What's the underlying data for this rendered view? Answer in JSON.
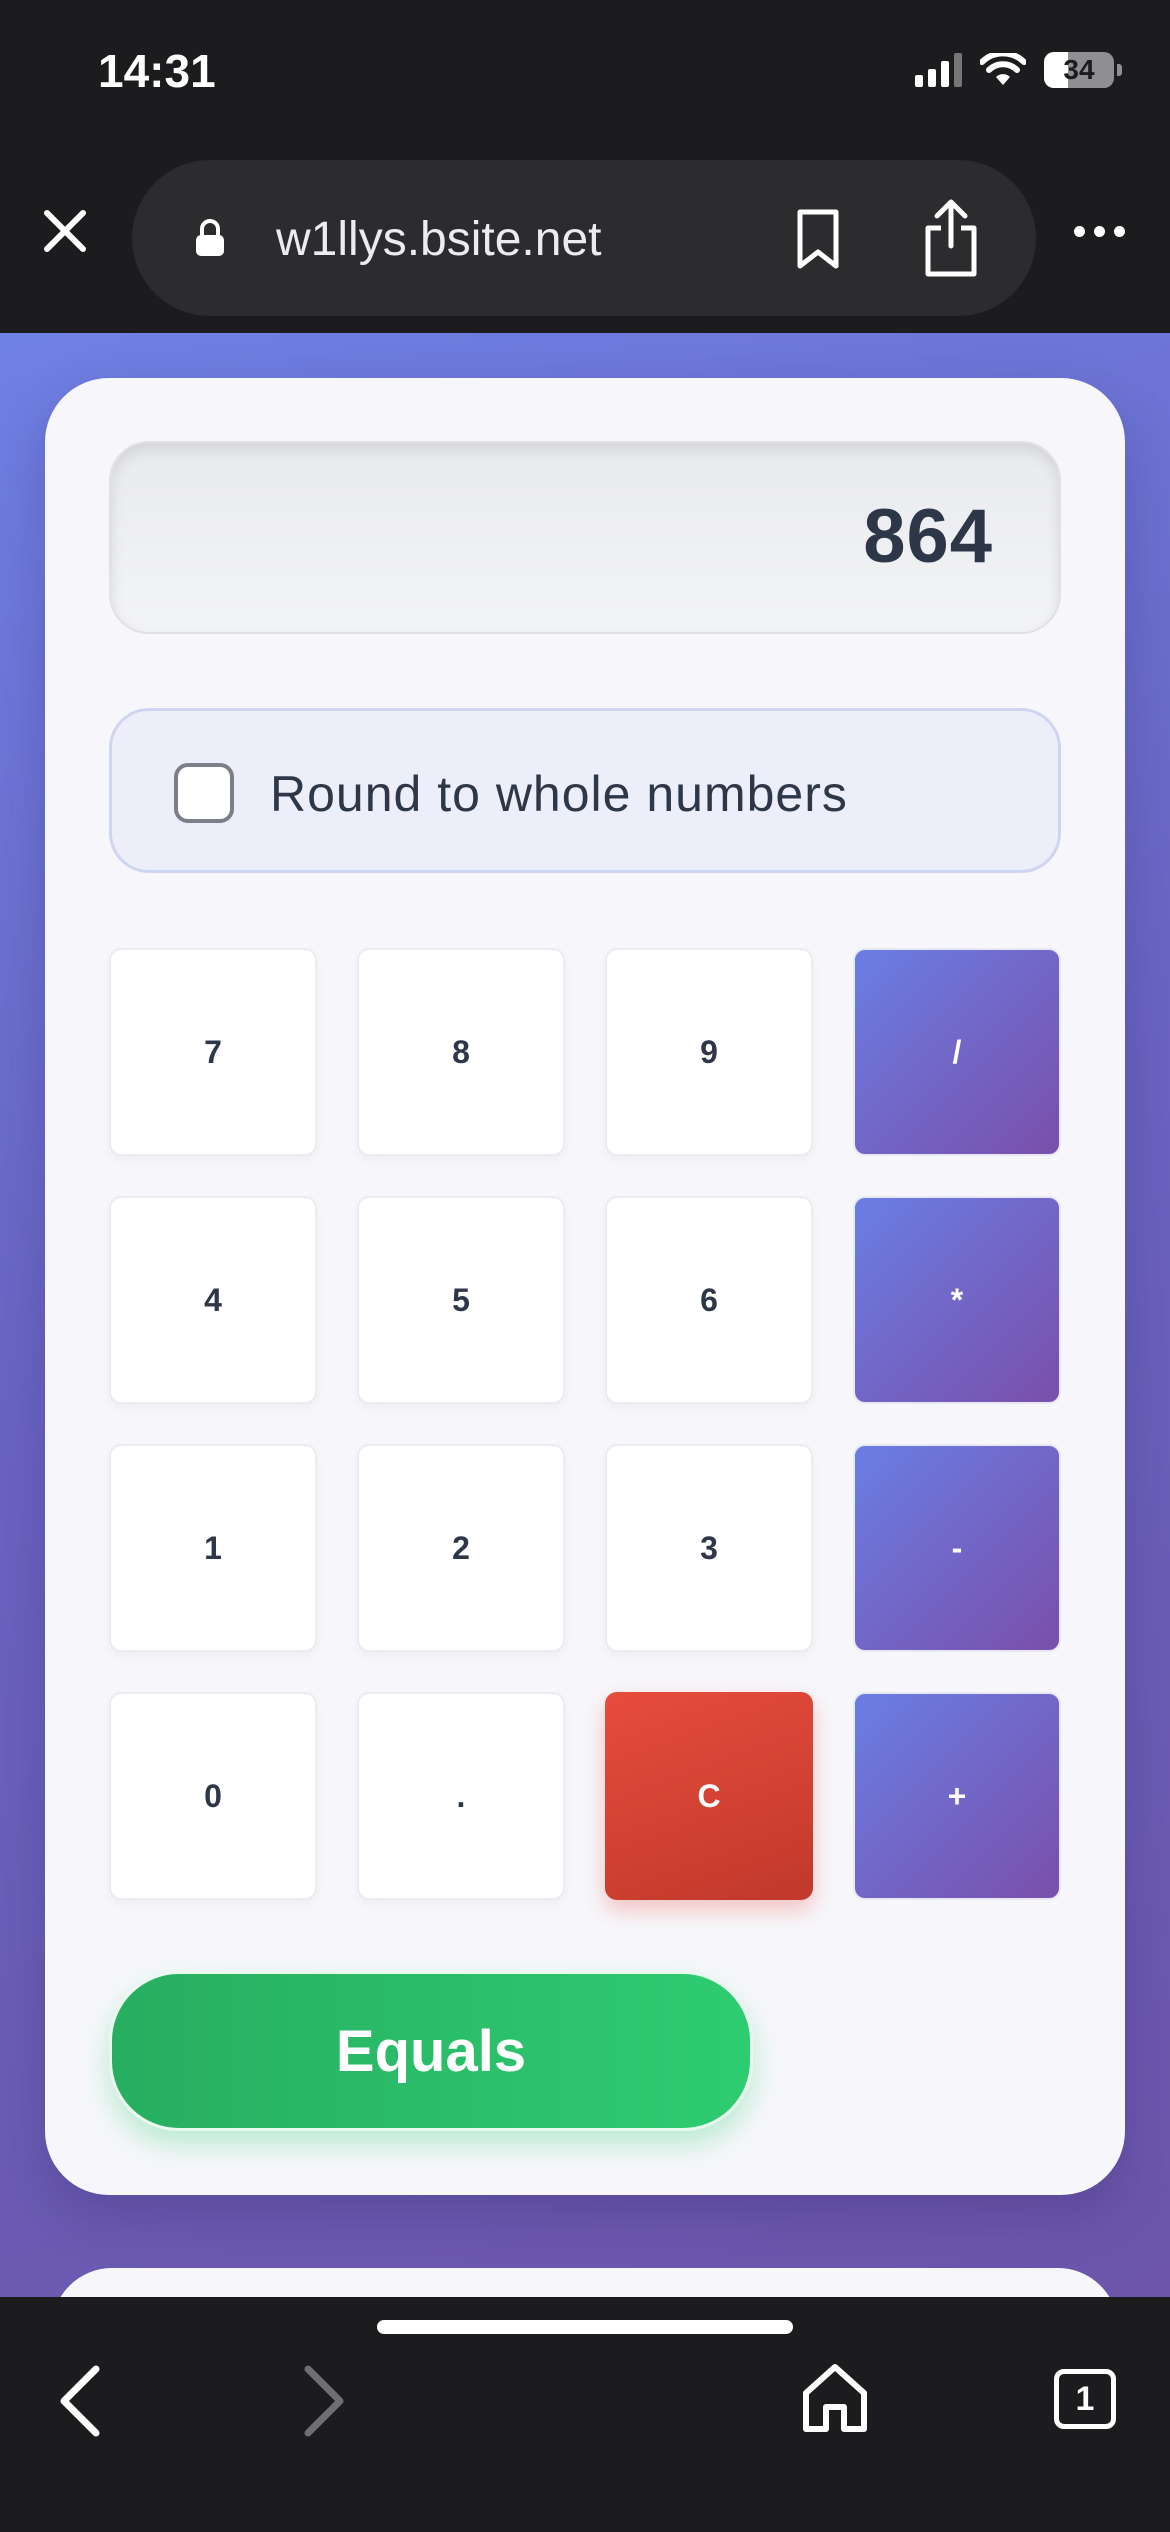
{
  "status_bar": {
    "time": "14:31",
    "battery": "34",
    "battery_level": 0.34
  },
  "browser": {
    "url": "w1llys.bsite.net",
    "tab_count": "1"
  },
  "calculator": {
    "display_value": "864",
    "round_label": "Round to whole numbers",
    "round_checked": false,
    "keys": [
      {
        "label": "7",
        "kind": "num"
      },
      {
        "label": "8",
        "kind": "num"
      },
      {
        "label": "9",
        "kind": "num"
      },
      {
        "label": "/",
        "kind": "op"
      },
      {
        "label": "4",
        "kind": "num"
      },
      {
        "label": "5",
        "kind": "num"
      },
      {
        "label": "6",
        "kind": "num"
      },
      {
        "label": "*",
        "kind": "op"
      },
      {
        "label": "1",
        "kind": "num"
      },
      {
        "label": "2",
        "kind": "num"
      },
      {
        "label": "3",
        "kind": "num"
      },
      {
        "label": "-",
        "kind": "op"
      },
      {
        "label": "0",
        "kind": "num"
      },
      {
        "label": ".",
        "kind": "num"
      },
      {
        "label": "C",
        "kind": "clear"
      },
      {
        "label": "+",
        "kind": "op"
      }
    ],
    "equals_label": "Equals"
  },
  "icons": {
    "close": "close-icon",
    "lock": "lock-icon",
    "bookmark": "bookmark-icon",
    "share": "share-icon",
    "more": "more-icon",
    "back": "chevron-left-icon",
    "forward": "chevron-right-icon",
    "home": "home-icon",
    "tabs": "tabs-icon"
  },
  "colors": {
    "accent_gradient_start": "#6a7ee3",
    "accent_gradient_end": "#7a4fab",
    "clear": "#e74c3c",
    "equals": "#2ecc71",
    "chrome": "#1c1c1e"
  }
}
